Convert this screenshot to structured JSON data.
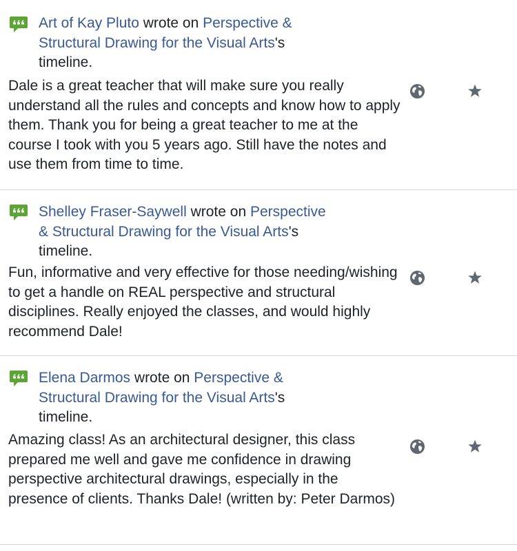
{
  "colors": {
    "link": "#385898",
    "text": "#1d2129",
    "icon_green": "#5ca534",
    "icon_gray": "#606770",
    "divider": "#d3d6db"
  },
  "posts": [
    {
      "author": "Art of Kay Pluto",
      "wrote_on": " wrote on ",
      "page": "Perspective & Structural Drawing for the Visual Arts",
      "suffix": "'s timeline.",
      "text": "Dale is a great teacher that will make sure you really understand all the rules and concepts and know how to apply them. Thank you for being a great teacher to me at the course I took with you 5 years ago. Still have the notes and use them from time to time.",
      "audience_icon": "globe-icon",
      "action_icon": "star-icon"
    },
    {
      "author": "Shelley Fraser-Saywell",
      "wrote_on": " wrote on ",
      "page": "Perspective & Structural Drawing for the Visual Arts",
      "suffix": "'s timeline.",
      "text": "Fun, informative and very effective for those needing/wishing to get a handle on REAL perspective and structural disciplines. Really enjoyed the classes, and would highly recommend Dale!",
      "audience_icon": "globe-icon",
      "action_icon": "star-icon"
    },
    {
      "author": "Elena Darmos",
      "wrote_on": " wrote on ",
      "page": "Perspective & Structural Drawing for the Visual Arts",
      "suffix": "'s timeline.",
      "text": "Amazing class! As an architectural designer, this class prepared me well and gave me confidence in drawing perspective architectural drawings, especially in the presence of clients. Thanks Dale! (written by: Peter Darmos)",
      "audience_icon": "globe-icon",
      "action_icon": "star-icon"
    }
  ]
}
